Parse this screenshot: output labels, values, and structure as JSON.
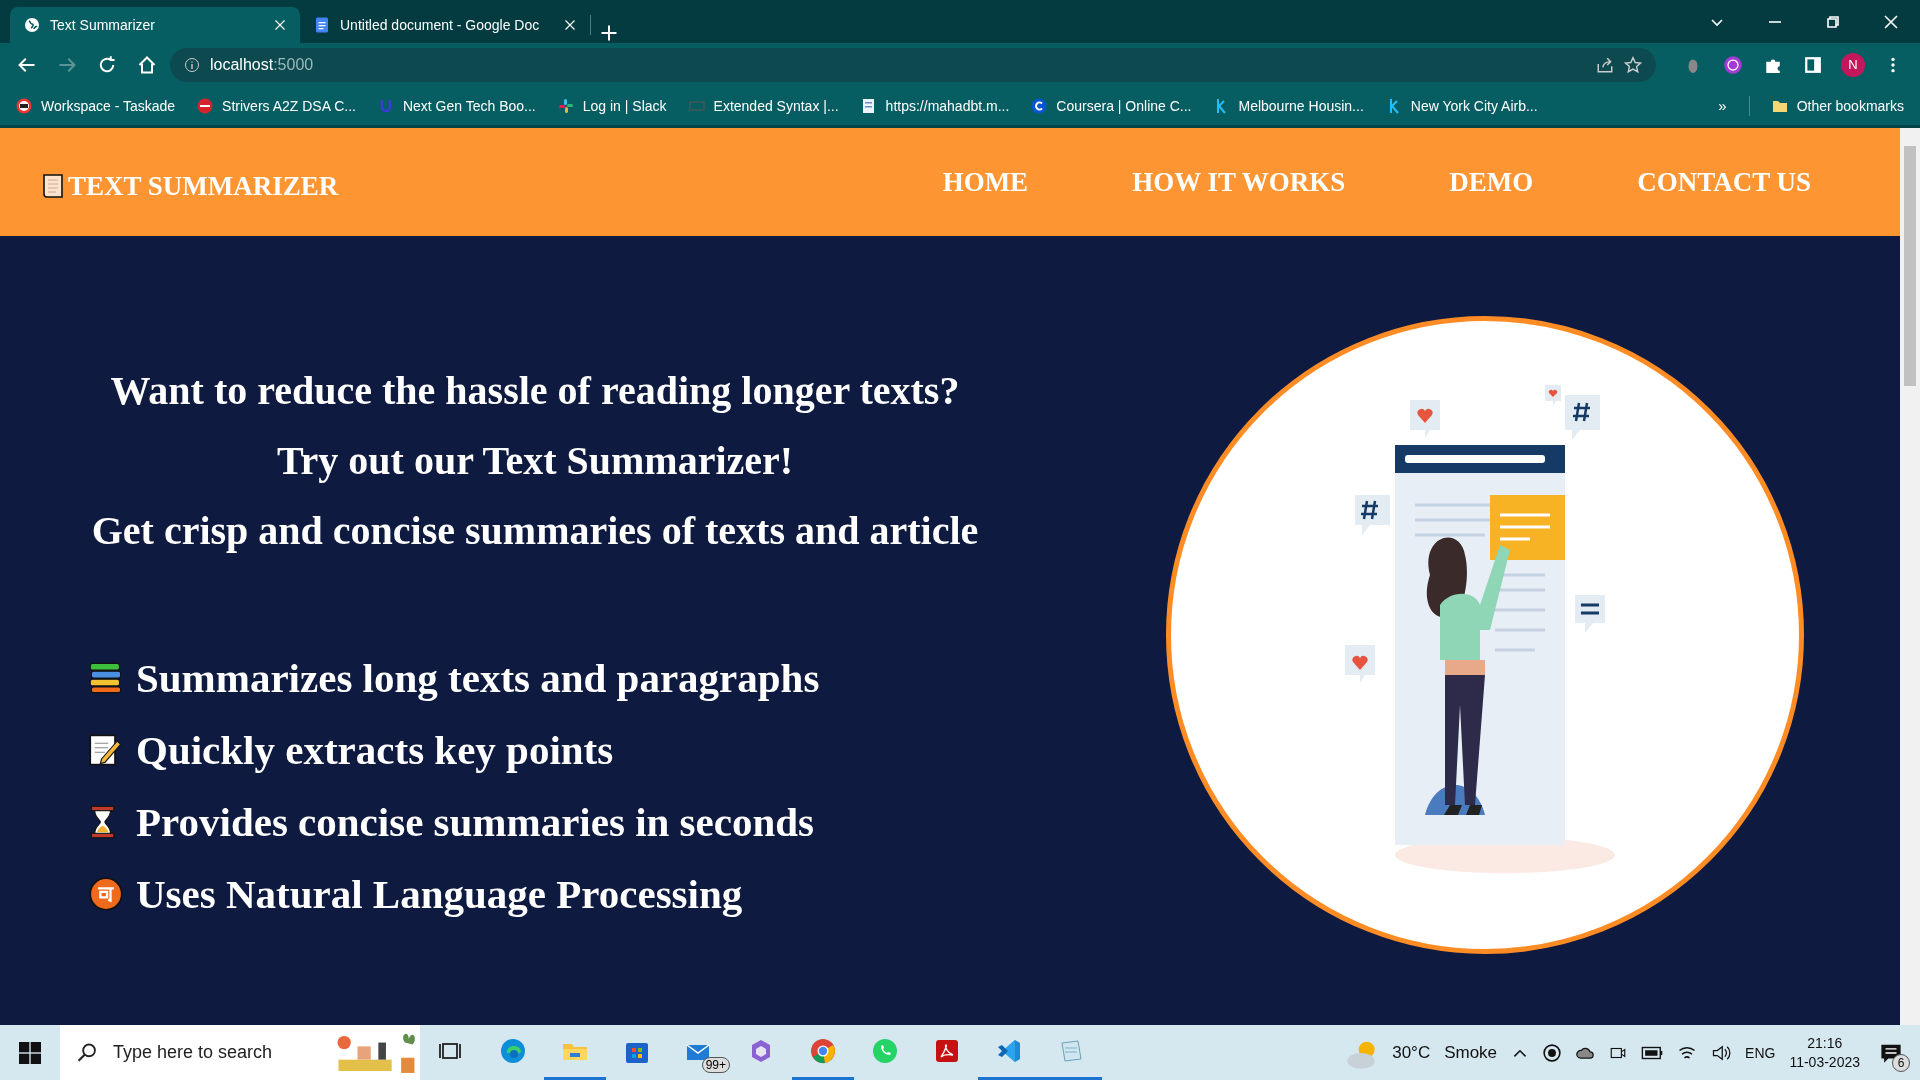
{
  "browser": {
    "tabs": [
      {
        "title": "Text Summarizer",
        "kind": "globe",
        "selected": true
      },
      {
        "title": "Untitled document - Google Doc",
        "kind": "doc",
        "selected": false
      }
    ],
    "forward_disabled": true,
    "address": {
      "host": "localhost",
      "port": ":5000"
    },
    "profile_initial": "N",
    "bookmarks": [
      {
        "label": "Workspace - Taskade",
        "kind": "taskade"
      },
      {
        "label": "Strivers A2Z DSA C...",
        "kind": "tuf"
      },
      {
        "label": "Next Gen Tech Boo...",
        "kind": "udacity"
      },
      {
        "label": "Log in | Slack",
        "kind": "slack"
      },
      {
        "label": "Extended Syntax |...",
        "kind": "markdown"
      },
      {
        "label": "https://mahadbt.m...",
        "kind": "page"
      },
      {
        "label": "Coursera | Online C...",
        "kind": "coursera"
      },
      {
        "label": "Melbourne Housin...",
        "kind": "kaggle"
      },
      {
        "label": "New York City Airb...",
        "kind": "kaggle"
      }
    ],
    "more": "»",
    "other_bookmarks": "Other bookmarks"
  },
  "page": {
    "brand": "TEXT SUMMARIZER",
    "nav": [
      "HOME",
      "HOW IT WORKS",
      "DEMO",
      "CONTACT US"
    ],
    "headings": [
      "Want to reduce the hassle of reading longer texts?",
      "Try out our Text Summarizer!",
      "Get crisp and concise summaries of texts and article"
    ],
    "features": [
      {
        "kind": "books",
        "text": "Summarizes long texts and paragraphs"
      },
      {
        "kind": "memo",
        "text": "Quickly extracts key points"
      },
      {
        "kind": "hourglass",
        "text": "Provides concise summaries in seconds"
      },
      {
        "kind": "badge",
        "text": "Uses Natural Language Processing"
      }
    ]
  },
  "taskbar": {
    "search_placeholder": "Type here to search",
    "apps": [
      {
        "kind": "taskview",
        "active": false
      },
      {
        "kind": "edge",
        "active": false
      },
      {
        "kind": "explorer",
        "active": true
      },
      {
        "kind": "store",
        "active": false
      },
      {
        "kind": "mail",
        "active": false,
        "badge": "99+"
      },
      {
        "kind": "copilot",
        "active": false
      },
      {
        "kind": "chrome",
        "active": true
      },
      {
        "kind": "whatsapp",
        "active": false
      },
      {
        "kind": "acrobat",
        "active": false
      },
      {
        "kind": "vscode",
        "active": true
      },
      {
        "kind": "notepad",
        "active": true
      }
    ],
    "weather": {
      "temp": "30°C",
      "condition": "Smoke"
    },
    "language": "ENG",
    "time": "21:16",
    "date": "11-03-2023",
    "notifications": "6"
  }
}
